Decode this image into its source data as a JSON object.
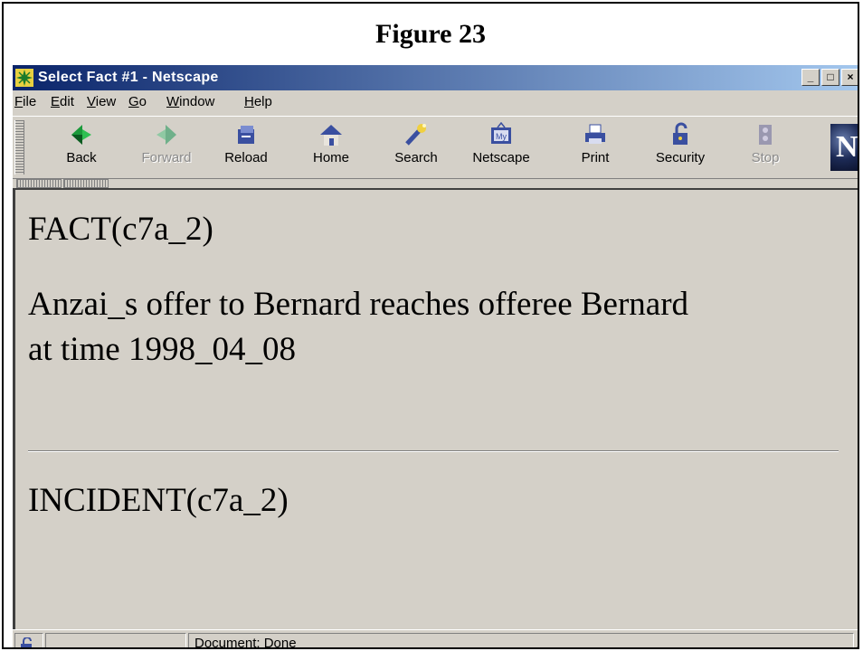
{
  "figure": {
    "title": "Figure 23"
  },
  "window": {
    "title": "Select Fact #1 - Netscape",
    "app_icon": "netscape-app-icon",
    "controls": {
      "minimize": "_",
      "maximize": "□",
      "close": "×"
    }
  },
  "menu": {
    "items": [
      {
        "label": "File",
        "accel": "F",
        "rest": "ile"
      },
      {
        "label": "Edit",
        "accel": "E",
        "rest": "dit"
      },
      {
        "label": "View",
        "accel": "V",
        "rest": "iew"
      },
      {
        "label": "Go",
        "accel": "G",
        "rest": "o"
      },
      {
        "label": "Window",
        "accel": "W",
        "rest": "indow"
      },
      {
        "label": "Help",
        "accel": "H",
        "rest": "elp"
      }
    ]
  },
  "toolbar": {
    "buttons": [
      {
        "label": "Back",
        "icon": "back-arrow-icon",
        "enabled": true
      },
      {
        "label": "Forward",
        "icon": "forward-arrow-icon",
        "enabled": false
      },
      {
        "label": "Reload",
        "icon": "reload-icon",
        "enabled": true
      },
      {
        "label": "Home",
        "icon": "home-icon",
        "enabled": true
      },
      {
        "label": "Search",
        "icon": "search-icon",
        "enabled": true
      },
      {
        "label": "Netscape",
        "icon": "my-netscape-icon",
        "enabled": true
      },
      {
        "label": "Print",
        "icon": "print-icon",
        "enabled": true
      },
      {
        "label": "Security",
        "icon": "security-lock-icon",
        "enabled": true
      },
      {
        "label": "Stop",
        "icon": "stop-icon",
        "enabled": false
      }
    ],
    "brand_letter": "N"
  },
  "content": {
    "fact_heading": "FACT(c7a_2)",
    "fact_text_line1": "Anzai_s offer to Bernard reaches offeree Bernard",
    "fact_text_line2": "at time 1998_04_08",
    "incident_heading": "INCIDENT(c7a_2)"
  },
  "status": {
    "text": "Document: Done",
    "icon": "security-padlock-icon"
  },
  "colors": {
    "window_face": "#d4d0c8",
    "titlebar_start": "#0a246a",
    "titlebar_end": "#a6caf0"
  }
}
